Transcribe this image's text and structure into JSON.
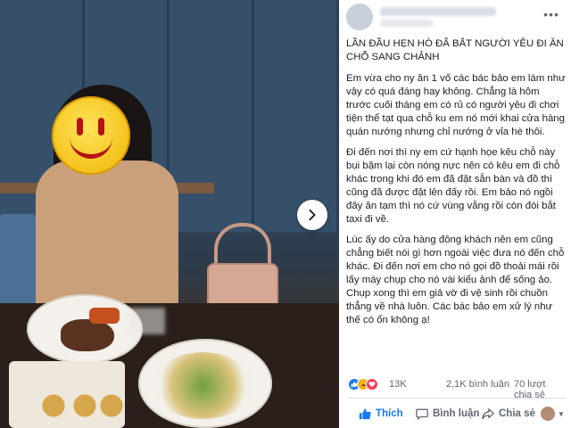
{
  "post": {
    "title": "LẦN ĐẦU HẸN HÒ ĐÃ BẮT NGƯỜI YÊU ĐI ĂN CHỖ SANG CHẢNH",
    "paragraphs": [
      "Em vừa cho ny ăn 1 vố các bác bảo em làm như vậy có quá đáng hay không. Chẳng là hôm trước cuối tháng em có rủ có người yêu đi chơi tiện thể tạt qua chỗ ku em nó mới khai cửa hàng quán nướng nhưng chỉ nướng ở vỉa hè thôi.",
      "Đi đến nơi thì ny em cứ hạnh họe kêu chỗ này bụi bặm lại còn nóng nực nên có kêu em đi chỗ khác trong khi đó em đã đặt sẵn bàn và đồ thì cũng đã được đặt lên đấy rồi. Em bảo nó ngồi đây ăn tạm thì nó cứ vùng vằng rồi còn đòi bắt taxi đi về.",
      "Lúc ấy do cửa hàng đông khách nên em cũng chẳng biết nói gì hơn ngoài việc đưa nó đến chỗ khác. Đi đến nơi em cho nó gọi đồ thoải mái rồi lấy máy chụp cho nó vài kiểu ảnh để sống ảo. Chụp xong thì em giả vờ đi vệ sinh rồi chuồn thẳng về nhà luôn. Các bác bảo em xử lý như thế có ổn không ạ!"
    ]
  },
  "stats": {
    "reaction_count": "13K",
    "comments": "2,1K bình luận",
    "shares": "70 lượt chia sẻ"
  },
  "actions": {
    "like": "Thích",
    "comment": "Bình luận",
    "share": "Chia sẻ"
  },
  "icons": {
    "next": "chevron-right-icon",
    "like": "thumbs-up-icon",
    "comment": "comment-icon",
    "share": "share-icon",
    "more": "more-icon"
  },
  "colors": {
    "accent": "#1877f2",
    "text": "#1c1e21",
    "muted": "#606770",
    "like_reaction": "#1877f2",
    "haha_reaction": "#f7b125",
    "love_reaction": "#f33e58"
  }
}
